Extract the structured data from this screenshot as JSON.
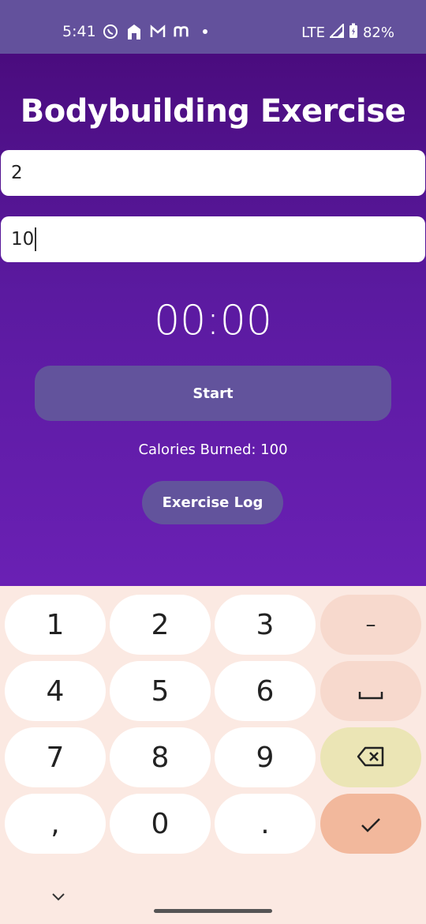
{
  "status_bar": {
    "time": "5:41",
    "notification_icons": [
      "whatsapp-icon",
      "home-icon",
      "gmail-icon",
      "m-app-icon",
      "dot-icon"
    ],
    "network": "LTE",
    "battery": "82%",
    "bg_color": "#63519c"
  },
  "app": {
    "title": "Bodybuilding Exercise",
    "field1_value": "2",
    "field2_value": "10",
    "timer": "00:00",
    "start_label": "Start",
    "calories_text": "Calories Burned: 100",
    "log_label": "Exercise Log",
    "button_color": "#62539c"
  },
  "keyboard": {
    "keys": [
      "1",
      "2",
      "3",
      "–",
      "4",
      "5",
      "6",
      "␣",
      "7",
      "8",
      "9",
      "backspace",
      ",",
      "0",
      ".",
      "enter"
    ],
    "accent_colors": {
      "func": "#f7d9cd",
      "delete": "#ebe5b5",
      "enter": "#f2b89c"
    }
  }
}
